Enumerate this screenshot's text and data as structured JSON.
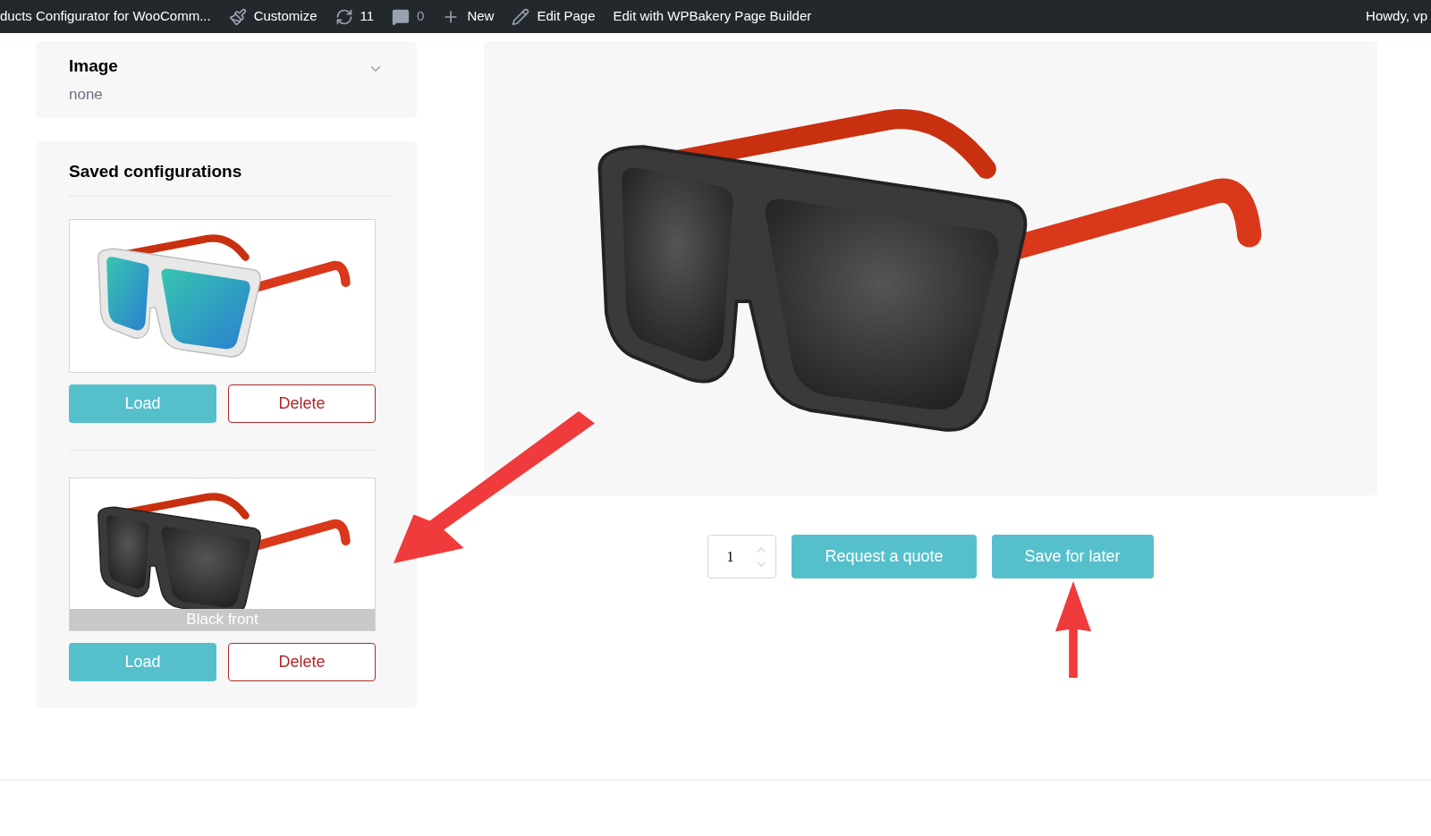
{
  "admin_bar": {
    "items": [
      {
        "kind": "text",
        "label": "ducts Configurator for WooComm..."
      },
      {
        "kind": "customize",
        "label": "Customize"
      },
      {
        "kind": "updates",
        "label": "11"
      },
      {
        "kind": "comments",
        "label": "0"
      },
      {
        "kind": "new",
        "label": "New"
      },
      {
        "kind": "edit",
        "label": "Edit Page"
      },
      {
        "kind": "text",
        "label": "Edit with WPBakery Page Builder"
      }
    ],
    "greeting": "Howdy, vp"
  },
  "image_option": {
    "title": "Image",
    "value": "none"
  },
  "saved": {
    "title": "Saved configurations",
    "items": [
      {
        "kind": "white-frame",
        "load": "Load",
        "delete": "Delete"
      },
      {
        "kind": "black-frame",
        "caption": "Black front",
        "load": "Load",
        "delete": "Delete"
      }
    ]
  },
  "product": {
    "kind": "black-frame",
    "quantity": "1",
    "buttons": [
      "Request a quote",
      "Save for later"
    ]
  }
}
